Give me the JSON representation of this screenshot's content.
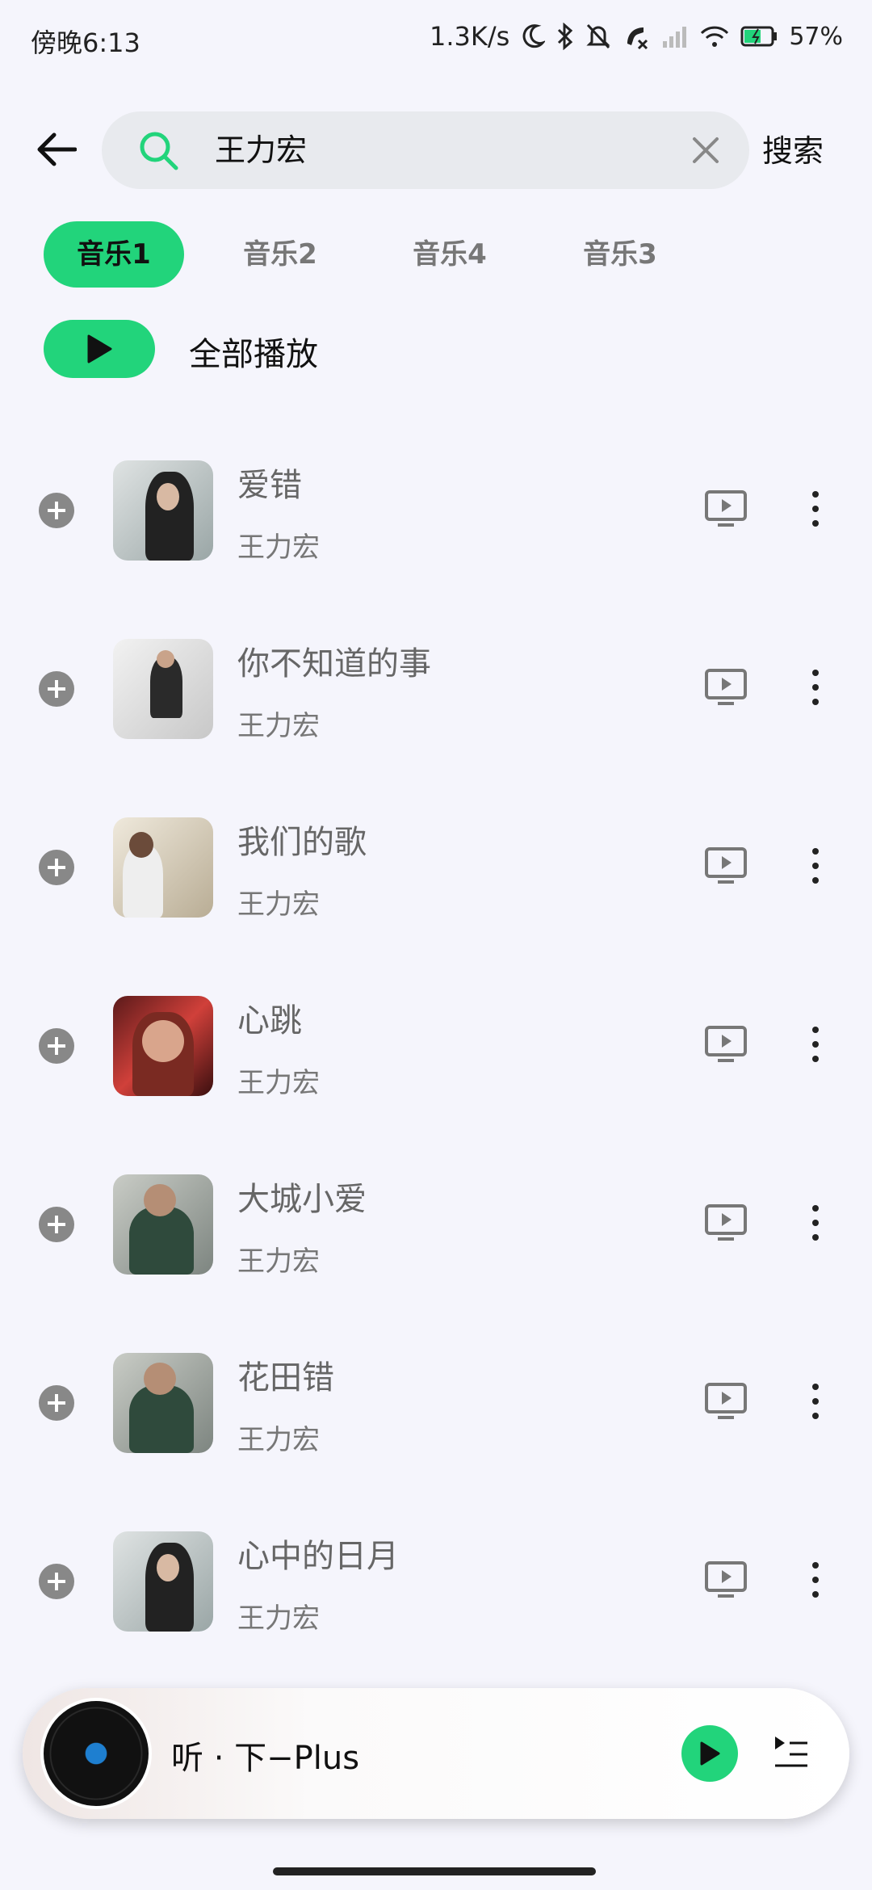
{
  "status_bar": {
    "time": "傍晚6:13",
    "net_speed": "1.3K/s",
    "battery": "57%"
  },
  "search": {
    "query": "王力宏",
    "button_label": "搜索"
  },
  "tabs": [
    {
      "label": "音乐1",
      "active": true
    },
    {
      "label": "音乐2",
      "active": false
    },
    {
      "label": "音乐4",
      "active": false
    },
    {
      "label": "音乐3",
      "active": false
    }
  ],
  "play_all_label": "全部播放",
  "songs": [
    {
      "title": "爱错",
      "artist": "王力宏"
    },
    {
      "title": "你不知道的事",
      "artist": "王力宏"
    },
    {
      "title": "我们的歌",
      "artist": "王力宏"
    },
    {
      "title": "心跳",
      "artist": "王力宏"
    },
    {
      "title": "大城小爱",
      "artist": "王力宏"
    },
    {
      "title": "花田错",
      "artist": "王力宏"
    },
    {
      "title": "心中的日月",
      "artist": "王力宏"
    }
  ],
  "player": {
    "now_playing": "听 · 下−Plus"
  },
  "colors": {
    "accent": "#22d47b",
    "background": "#f5f5fc"
  },
  "icons": [
    "back-arrow-icon",
    "search-icon",
    "clear-icon",
    "play-icon",
    "add-icon",
    "mv-icon",
    "more-icon",
    "playlist-icon",
    "vinyl-icon"
  ]
}
